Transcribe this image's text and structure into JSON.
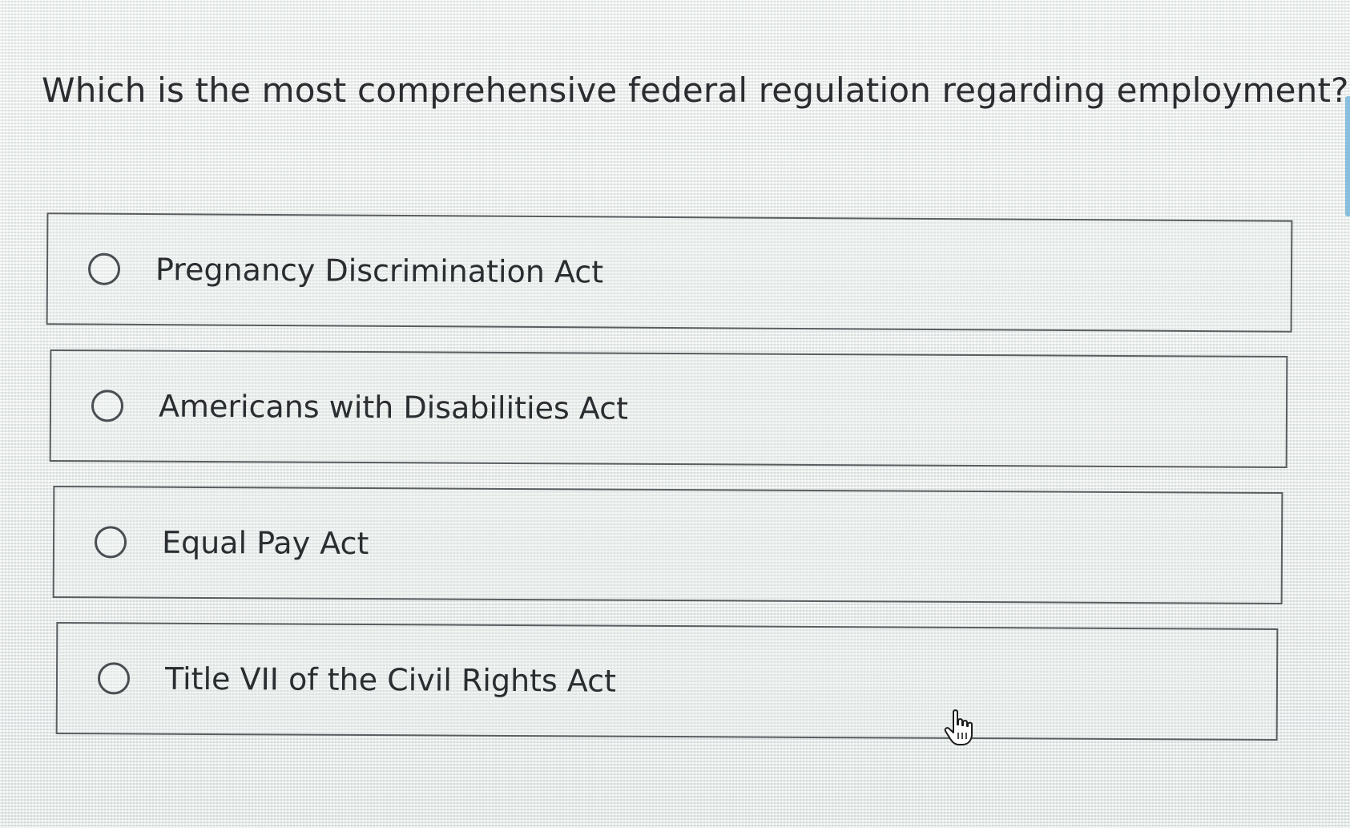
{
  "question": {
    "text": "Which is the most comprehensive federal regulation regarding employment?"
  },
  "options": [
    {
      "label": "Pregnancy Discrimination Act",
      "selected": false
    },
    {
      "label": "Americans with Disabilities Act",
      "selected": false
    },
    {
      "label": "Equal Pay Act",
      "selected": false
    },
    {
      "label": "Title VII of the Civil Rights Act",
      "selected": false
    }
  ],
  "cursor": {
    "icon": "hand-pointer-icon"
  },
  "colors": {
    "text": "#2b2d30",
    "border": "#5a5e61",
    "radio": "#4a4e52",
    "background": "#e9ecea"
  }
}
